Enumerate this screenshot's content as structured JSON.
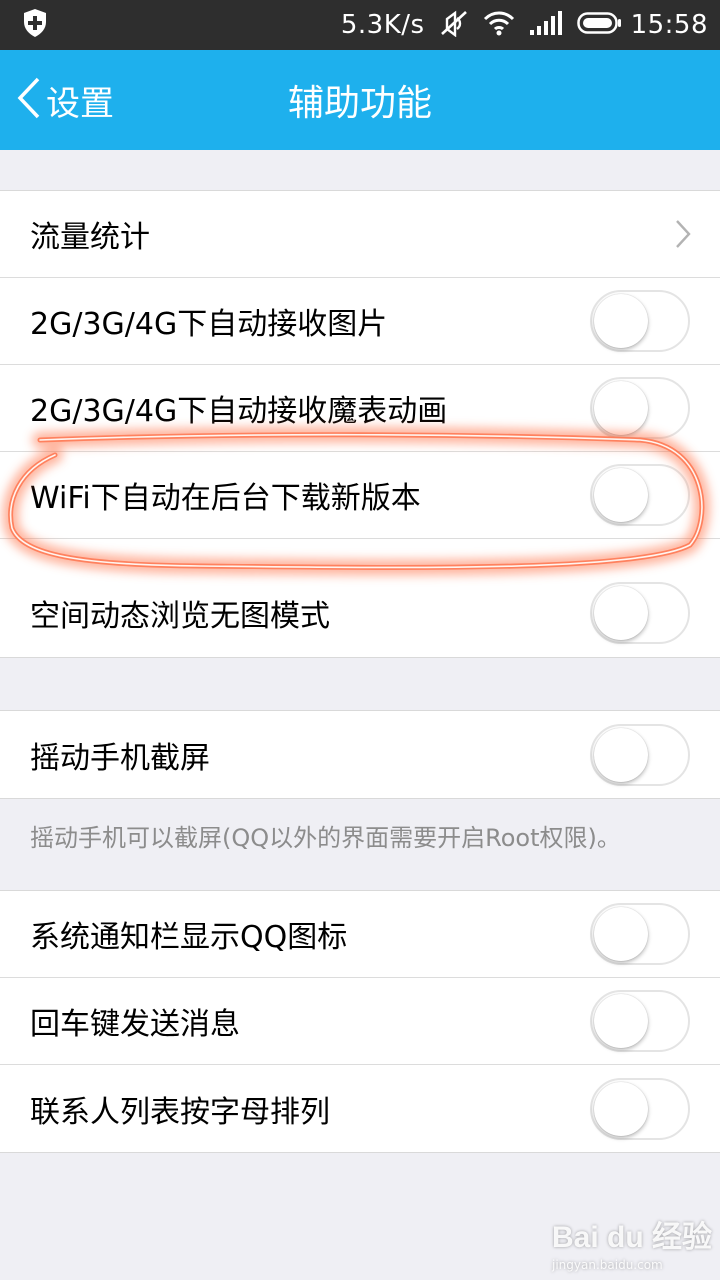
{
  "status_bar": {
    "speed": "5.3K/s",
    "time": "15:58",
    "icons": [
      "shield-plus-icon",
      "mute-icon",
      "wifi-icon",
      "signal-icon",
      "battery-icon"
    ]
  },
  "nav": {
    "back_label": "设置",
    "title": "辅助功能",
    "color": "#1eb0ed"
  },
  "groups": [
    {
      "items": [
        {
          "label": "流量统计",
          "control": "chevron"
        },
        {
          "label": "2G/3G/4G下自动接收图片",
          "control": "toggle",
          "on": false
        },
        {
          "label": "2G/3G/4G下自动接收魔表动画",
          "control": "toggle",
          "on": false
        },
        {
          "label": "WiFi下自动在后台下载新版本",
          "control": "toggle",
          "on": false
        },
        {
          "label": "空间动态浏览无图模式",
          "control": "toggle",
          "on": false
        }
      ]
    },
    {
      "items": [
        {
          "label": "摇动手机截屏",
          "control": "toggle",
          "on": false
        }
      ],
      "hint": "摇动手机可以截屏(QQ以外的界面需要开启Root权限)。"
    },
    {
      "items": [
        {
          "label": "系统通知栏显示QQ图标",
          "control": "toggle",
          "on": false
        },
        {
          "label": "回车键发送消息",
          "control": "toggle",
          "on": false
        },
        {
          "label": "联系人列表按字母排列",
          "control": "toggle",
          "on": false
        }
      ]
    }
  ],
  "annotation": {
    "color": "#ff6a3c"
  },
  "watermark": {
    "logo": "Bai du 经验",
    "url": "jingyan.baidu.com"
  }
}
